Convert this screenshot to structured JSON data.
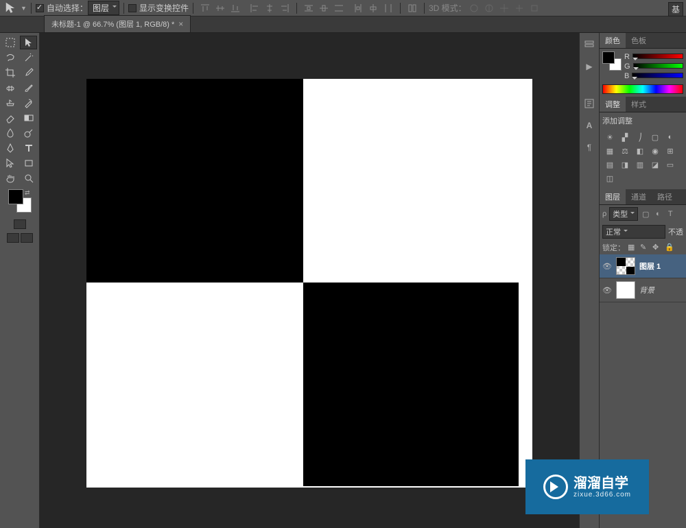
{
  "option_bar": {
    "auto_select_label": "自动选择：",
    "auto_select_value": "图层",
    "show_transform_label": "显示变换控件",
    "mode3d_label": "3D 模式："
  },
  "top_right_button": "基",
  "document_tab": {
    "title": "未标题-1 @ 66.7% (图层 1, RGB/8) *"
  },
  "panels": {
    "color": {
      "tab1": "颜色",
      "tab2": "色板",
      "r": "R",
      "g": "G",
      "b": "B"
    },
    "adjust": {
      "tab1": "调整",
      "tab2": "样式",
      "label": "添加调整"
    },
    "layers": {
      "tab1": "图层",
      "tab2": "通道",
      "tab3": "路径",
      "filter_kind": "类型",
      "blend_mode": "正常",
      "opacity_label": "不透",
      "lock_label": "锁定：",
      "layer1": "图层 1",
      "background": "背景"
    }
  },
  "watermark": {
    "brand": "溜溜自学",
    "sub": "zixue.3d66.com"
  },
  "colors": {
    "fg": "#000000",
    "bg": "#ffffff"
  }
}
